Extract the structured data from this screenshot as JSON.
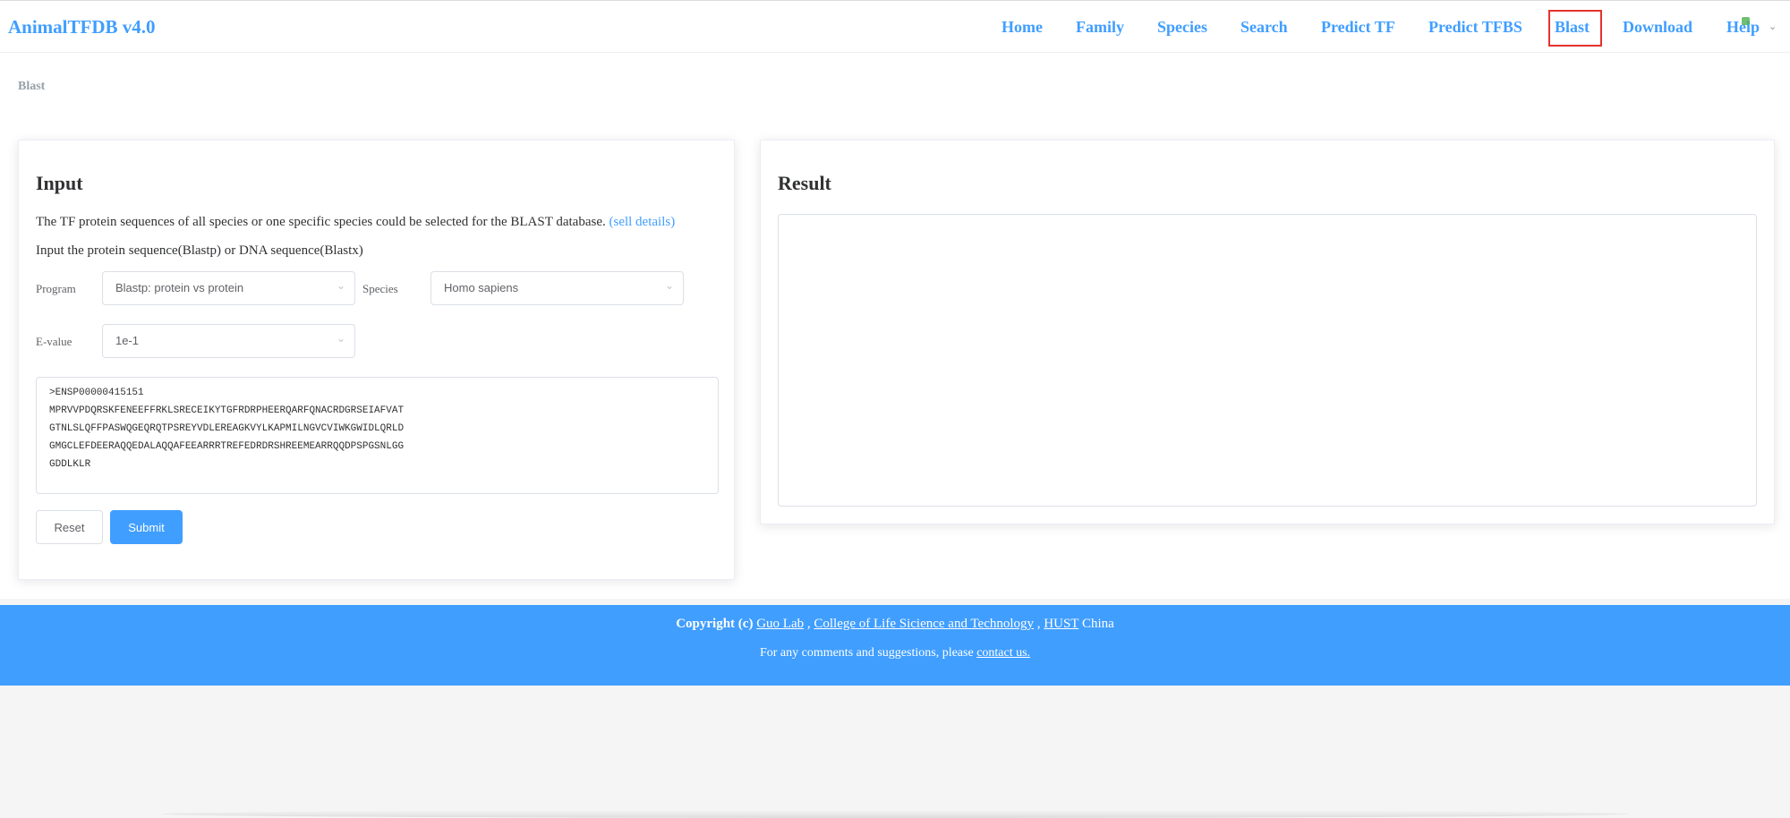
{
  "app": {
    "title": "AnimalTFDB v4.0"
  },
  "nav": {
    "items": [
      {
        "label": "Home"
      },
      {
        "label": "Family"
      },
      {
        "label": "Species"
      },
      {
        "label": "Search"
      },
      {
        "label": "Predict TF"
      },
      {
        "label": "Predict TFBS"
      },
      {
        "label": "Blast"
      },
      {
        "label": "Download"
      },
      {
        "label": "Help"
      }
    ],
    "active": "Blast"
  },
  "breadcrumb": "Blast",
  "input_panel": {
    "title": "Input",
    "desc1": "The TF protein sequences of all species or one specific species could be selected for the BLAST database.",
    "desc1_link": "(sell details)",
    "desc2": "Input the protein sequence(Blastp) or DNA sequence(Blastx)",
    "program_label": "Program",
    "program_value": "Blastp: protein vs protein",
    "species_label": "Species",
    "species_value": "Homo sapiens",
    "evalue_label": "E-value",
    "evalue_value": "1e-1",
    "sequence": ">ENSP00000415151\nMPRVVPDQRSKFENEEFFRKLSRECEIKYTGFRDRPHEERQARFQNACRDGRSEIAFVAT\nGTNLSLQFFPASWQGEQRQTPSREYVDLEREAGKVYLKAPMILNGVCVIWKGWIDLQRLD\nGMGCLEFDEERAQQEDALAQQAFEEARRRTREFEDRDRSHREEMEARRQQDPSPGSNLGG\nGDDLKLR",
    "reset_label": "Reset",
    "submit_label": "Submit"
  },
  "result_panel": {
    "title": "Result",
    "content": ""
  },
  "footer": {
    "copyright_prefix": "Copyright (c)",
    "lab": "Guo Lab",
    "sep1": ",",
    "college": "College of Life Sicience and Technology",
    "sep2": ",",
    "university": "HUST",
    "country": "China",
    "contact_prefix": "For any comments and suggestions, please",
    "contact_link": "contact us."
  },
  "colors": {
    "accent": "#409eff",
    "annotation": "#e3332c"
  }
}
